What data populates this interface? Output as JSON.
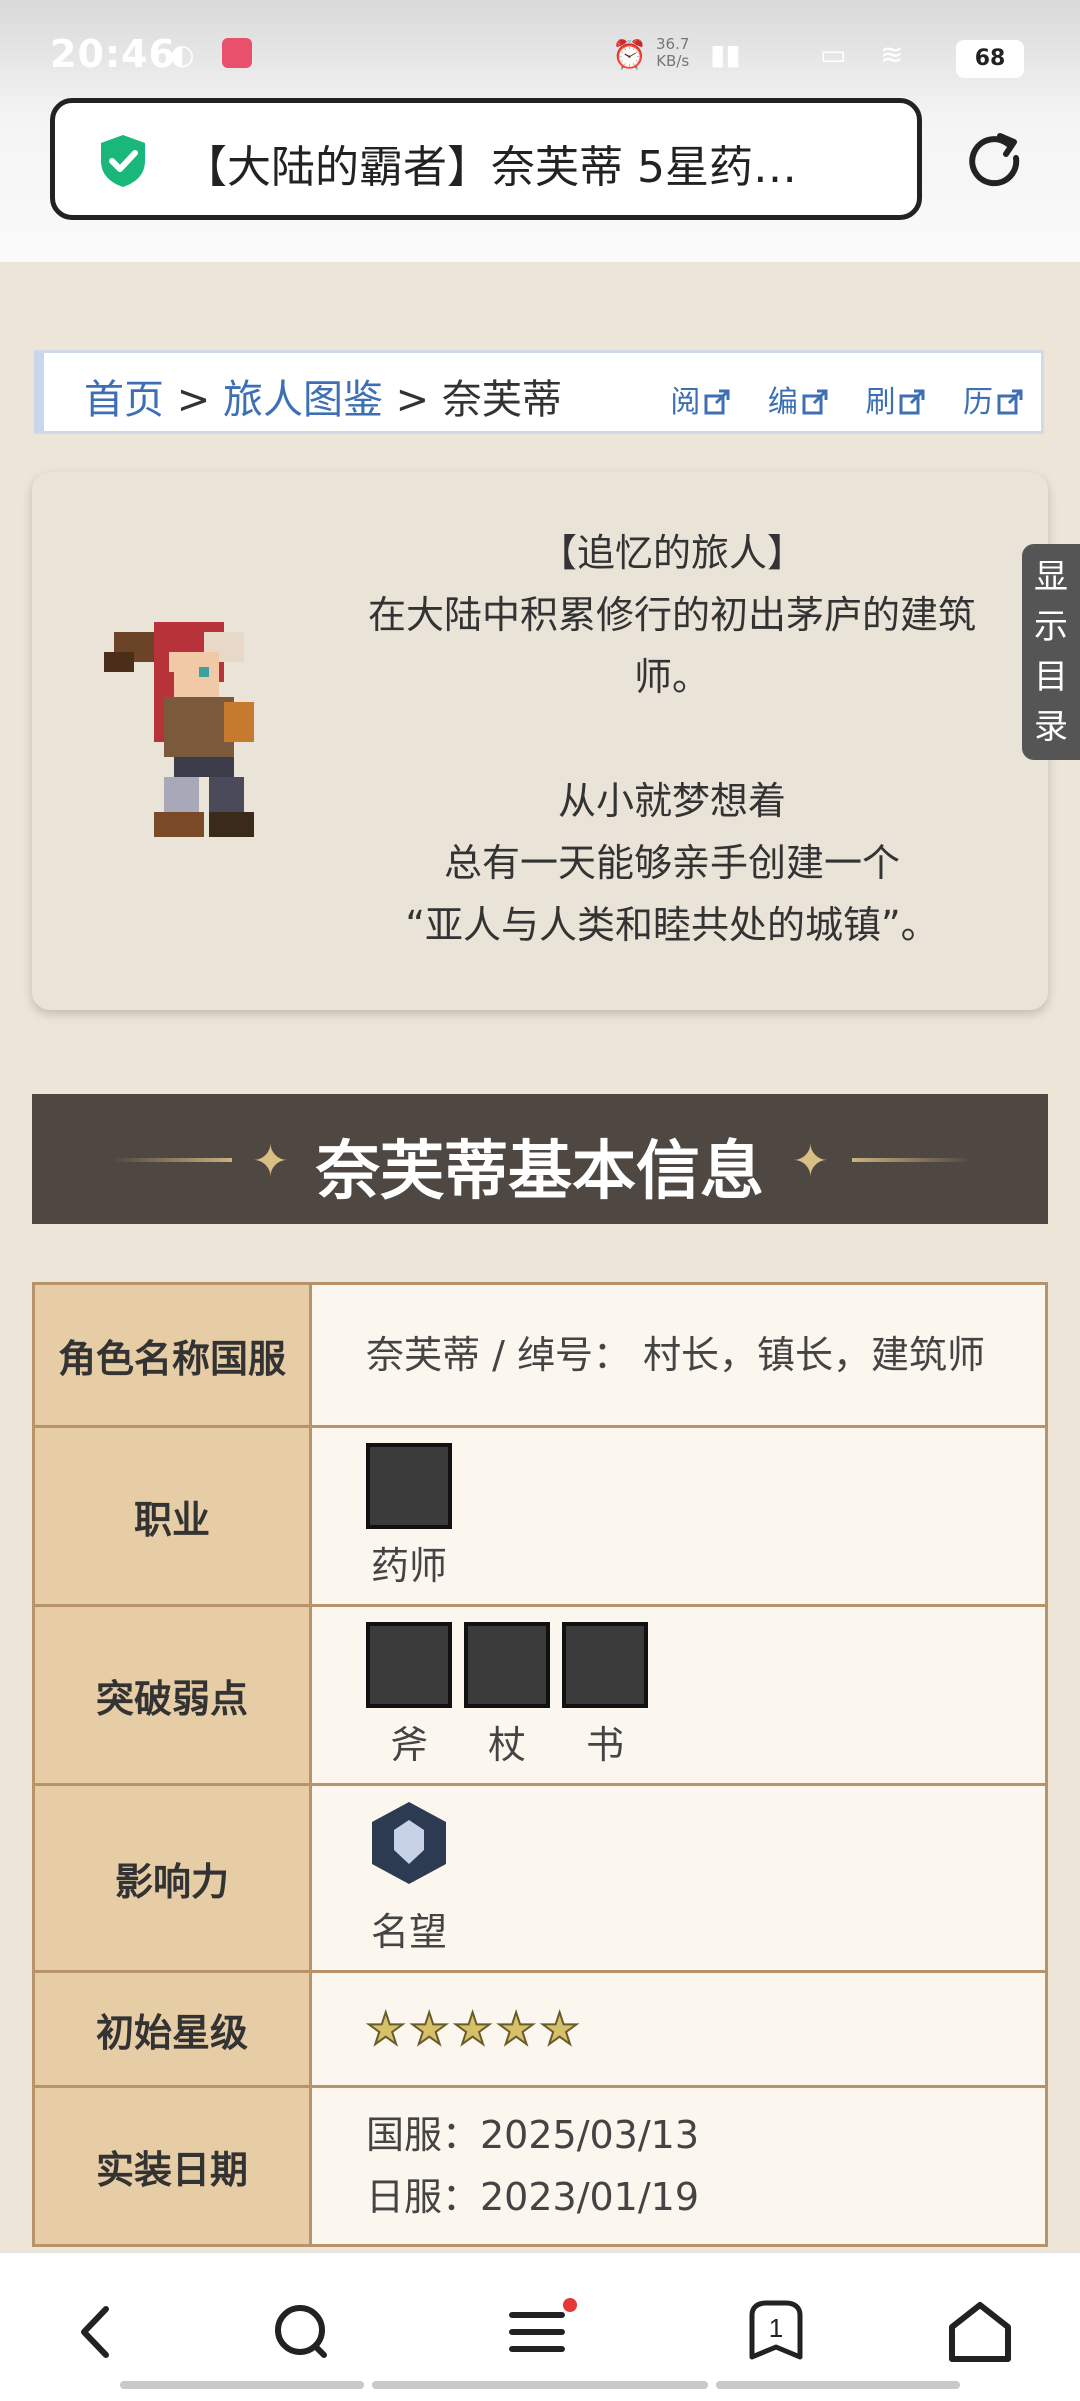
{
  "status_bar": {
    "time": "20:46",
    "net_speed_top": "36.7",
    "net_speed_unit": "KB/s",
    "battery": "68"
  },
  "address_bar": {
    "title": "【大陆的霸者】奈芙蒂 5星药…"
  },
  "breadcrumb": {
    "home": "首页",
    "sep1": ">",
    "category": "旅人图鉴",
    "sep2": ">",
    "current": "奈芙蒂",
    "tools": [
      "阅",
      "编",
      "刷",
      "历"
    ]
  },
  "side_tab": {
    "label": "显示目录"
  },
  "intro": {
    "lines": [
      "【追忆的旅人】",
      "在大陆中积累修行的初出茅庐的建筑",
      "师。",
      "",
      "从小就梦想着",
      "总有一天能够亲手创建一个",
      "“亚人与人类和睦共处的城镇”。"
    ]
  },
  "section": {
    "heading": "奈芙蒂基本信息"
  },
  "info": {
    "rows": [
      {
        "key": "角色名称国服",
        "value": "奈芙蒂 / 绰号： 村长，镇长，建筑师"
      },
      {
        "key": "职业",
        "icons": [
          {
            "name": "药师"
          }
        ]
      },
      {
        "key": "突破弱点",
        "icons": [
          {
            "name": "斧"
          },
          {
            "name": "杖"
          },
          {
            "name": "书"
          }
        ]
      },
      {
        "key": "影响力",
        "icons": [
          {
            "name": "名望"
          }
        ]
      },
      {
        "key": "初始星级",
        "stars": 5
      },
      {
        "key": "实装日期",
        "lines": [
          "国服：2025/03/13",
          "日服：2023/01/19"
        ]
      }
    ]
  },
  "colors": {
    "accent_link": "#3c6fb3",
    "header_bg": "#4f4741",
    "key_cell_bg": "#e7cda6",
    "table_border": "#b8936a"
  }
}
